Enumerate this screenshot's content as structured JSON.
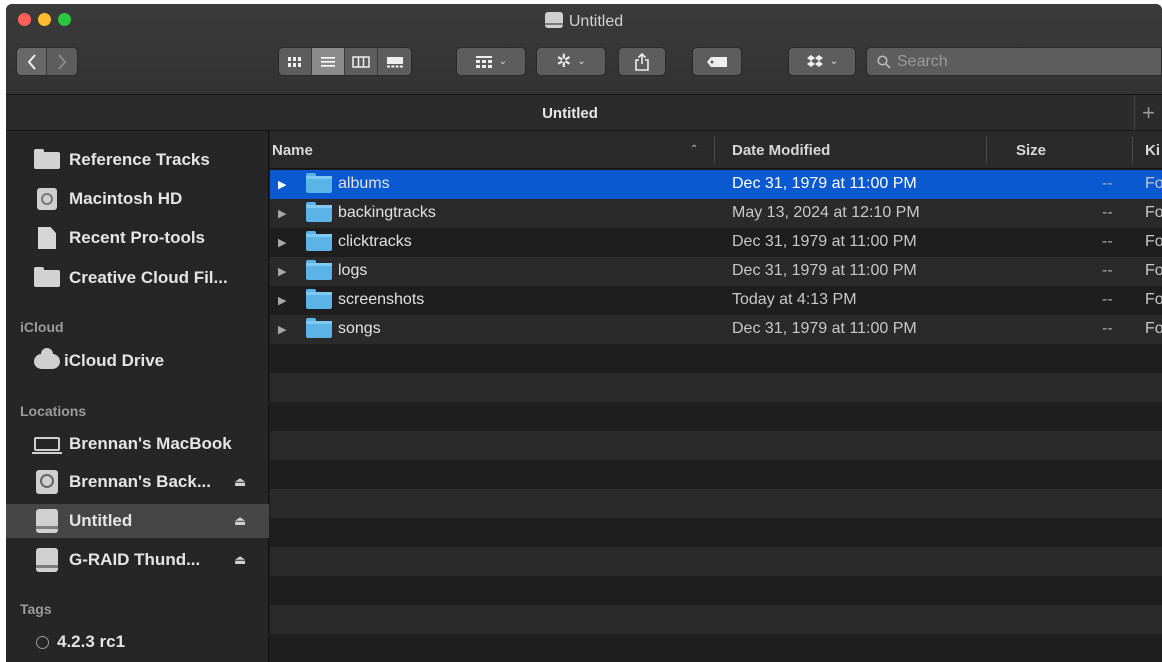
{
  "window": {
    "title": "Untitled"
  },
  "toolbar": {
    "search_placeholder": "Search",
    "view_buttons": [
      "icon-view",
      "list-view",
      "column-view",
      "gallery-view"
    ],
    "active_view": "list-view"
  },
  "tabs": {
    "active_label": "Untitled",
    "add_label": "+"
  },
  "sidebar": {
    "favorites": [
      {
        "label": "Reference Tracks",
        "icon": "folder-icon"
      },
      {
        "label": "Macintosh HD",
        "icon": "hard-drive-icon"
      },
      {
        "label": "Recent Pro-tools",
        "icon": "document-icon"
      },
      {
        "label": "Creative Cloud Fil...",
        "icon": "folder-icon"
      }
    ],
    "icloud_header": "iCloud",
    "icloud": [
      {
        "label": "iCloud Drive",
        "icon": "cloud-icon"
      }
    ],
    "locations_header": "Locations",
    "locations": [
      {
        "label": "Brennan's MacBook",
        "icon": "laptop-icon",
        "eject": ""
      },
      {
        "label": "Brennan's Back...",
        "icon": "time-machine-icon",
        "eject": "⏏"
      },
      {
        "label": "Untitled",
        "icon": "external-drive-icon",
        "eject": "⏏",
        "selected": true
      },
      {
        "label": "G-RAID Thund...",
        "icon": "external-drive-icon",
        "eject": "⏏"
      }
    ],
    "tags_header": "Tags",
    "tags": [
      {
        "label": "4.2.3 rc1",
        "icon": "tag-circle-icon"
      }
    ]
  },
  "file_list": {
    "columns": {
      "name": "Name",
      "date_modified": "Date Modified",
      "size": "Size",
      "kind": "Ki"
    },
    "rows": [
      {
        "name": "albums",
        "date": "Dec 31, 1979 at 11:00 PM",
        "size": "--",
        "kind": "Fo",
        "selected": true
      },
      {
        "name": "backingtracks",
        "date": "May 13, 2024 at 12:10 PM",
        "size": "--",
        "kind": "Fo"
      },
      {
        "name": "clicktracks",
        "date": "Dec 31, 1979 at 11:00 PM",
        "size": "--",
        "kind": "Fo"
      },
      {
        "name": "logs",
        "date": "Dec 31, 1979 at 11:00 PM",
        "size": "--",
        "kind": "Fo"
      },
      {
        "name": "screenshots",
        "date": "Today at 4:13 PM",
        "size": "--",
        "kind": "Fo"
      },
      {
        "name": "songs",
        "date": "Dec 31, 1979 at 11:00 PM",
        "size": "--",
        "kind": "Fo"
      }
    ]
  },
  "colors": {
    "selection": "#0b59d1",
    "folder": "#5ab4e8",
    "close": "#fe5f57",
    "minimize": "#febc2e",
    "maximize": "#28c840"
  }
}
